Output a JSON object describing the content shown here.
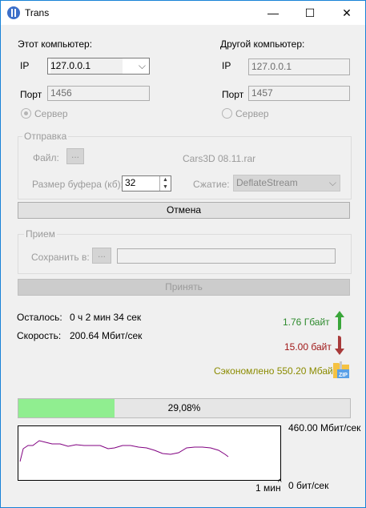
{
  "window": {
    "title": "Trans",
    "minimize": "—",
    "maximize": "☐",
    "close": "✕"
  },
  "local": {
    "heading": "Этот компьютер:",
    "ip_label": "IP",
    "ip_value": "127.0.0.1",
    "port_label": "Порт",
    "port_value": "1456",
    "server_label": "Сервер",
    "server_checked": true
  },
  "remote": {
    "heading": "Другой компьютер:",
    "ip_label": "IP",
    "ip_value": "127.0.0.1",
    "port_label": "Порт",
    "port_value": "1457",
    "server_label": "Сервер",
    "server_checked": false
  },
  "send": {
    "group_label": "Отправка",
    "file_label": "Файл:",
    "browse_label": "...",
    "file_name": "Cars3D 08.11.rar",
    "buffer_label": "Размер буфера (кб):",
    "buffer_value": "32",
    "compression_label": "Сжатие:",
    "compression_value": "DeflateStream"
  },
  "cancel_button": "Отмена",
  "receive": {
    "group_label": "Прием",
    "save_label": "Сохранить в:",
    "browse_label": "...",
    "path_value": ""
  },
  "accept_button": "Принять",
  "stats": {
    "remaining_label": "Осталось:",
    "remaining_value": "0 ч 2 мин 34 сек",
    "speed_label": "Скорость:",
    "speed_value": "200.64 Мбит/сек",
    "uploaded": "1.76 Гбайт",
    "downloaded": "15.00 байт",
    "saved": "Сэкономлено 550.20 Мбайт",
    "uploaded_color": "#2e8b2e",
    "downloaded_color": "#a01818",
    "saved_color": "#8b8b00"
  },
  "progress": {
    "text": "29,08%",
    "fraction": 0.2908
  },
  "graph": {
    "max_label": "460.00 Мбит/сек",
    "min_label": "0 бит/сек",
    "time_label": "1 мин",
    "line_color": "#800080"
  }
}
